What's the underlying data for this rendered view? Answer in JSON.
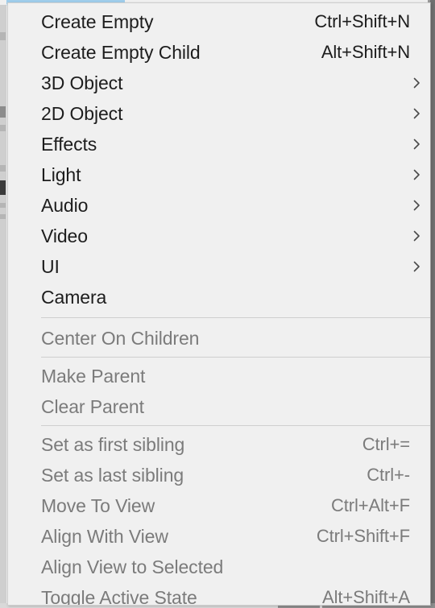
{
  "window": {
    "background_color": "#f0f0f0",
    "accent_color": "#9fcdeb",
    "menu_background": "#f0f0f0",
    "menu_border": "#cfcfcf",
    "text_color": "#1d1d1d",
    "disabled_text_color": "#7b7b7b",
    "separator_color": "#cfcfcf"
  },
  "menu": {
    "name": "gameobject-context-menu",
    "groups": [
      {
        "name": "create-group",
        "items": [
          {
            "label": "Create Empty",
            "shortcut": "Ctrl+Shift+N",
            "submenu": false,
            "enabled": true
          },
          {
            "label": "Create Empty Child",
            "shortcut": "Alt+Shift+N",
            "submenu": false,
            "enabled": true
          },
          {
            "label": "3D Object",
            "shortcut": "",
            "submenu": true,
            "enabled": true
          },
          {
            "label": "2D Object",
            "shortcut": "",
            "submenu": true,
            "enabled": true
          },
          {
            "label": "Effects",
            "shortcut": "",
            "submenu": true,
            "enabled": true
          },
          {
            "label": "Light",
            "shortcut": "",
            "submenu": true,
            "enabled": true
          },
          {
            "label": "Audio",
            "shortcut": "",
            "submenu": true,
            "enabled": true
          },
          {
            "label": "Video",
            "shortcut": "",
            "submenu": true,
            "enabled": true
          },
          {
            "label": "UI",
            "shortcut": "",
            "submenu": true,
            "enabled": true
          },
          {
            "label": "Camera",
            "shortcut": "",
            "submenu": false,
            "enabled": true
          }
        ]
      },
      {
        "name": "center-group",
        "items": [
          {
            "label": "Center On Children",
            "shortcut": "",
            "submenu": false,
            "enabled": false
          }
        ]
      },
      {
        "name": "parent-group",
        "items": [
          {
            "label": "Make Parent",
            "shortcut": "",
            "submenu": false,
            "enabled": false
          },
          {
            "label": "Clear Parent",
            "shortcut": "",
            "submenu": false,
            "enabled": false
          }
        ]
      },
      {
        "name": "sibling-view-group",
        "items": [
          {
            "label": "Set as first sibling",
            "shortcut": "Ctrl+=",
            "submenu": false,
            "enabled": false
          },
          {
            "label": "Set as last sibling",
            "shortcut": "Ctrl+-",
            "submenu": false,
            "enabled": false
          },
          {
            "label": "Move To View",
            "shortcut": "Ctrl+Alt+F",
            "submenu": false,
            "enabled": false
          },
          {
            "label": "Align With View",
            "shortcut": "Ctrl+Shift+F",
            "submenu": false,
            "enabled": false
          },
          {
            "label": "Align View to Selected",
            "shortcut": "",
            "submenu": false,
            "enabled": false
          },
          {
            "label": "Toggle Active State",
            "shortcut": "Alt+Shift+A",
            "submenu": false,
            "enabled": false
          }
        ]
      }
    ]
  },
  "icons": {
    "submenu_arrow": "chevron-right-icon"
  }
}
